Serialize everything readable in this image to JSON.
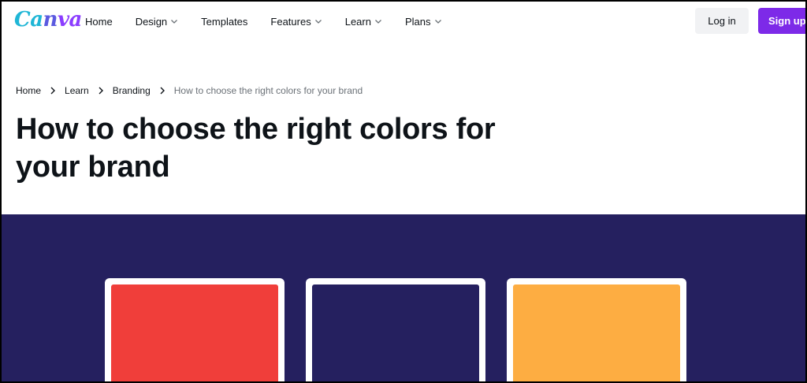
{
  "brand": {
    "logo_text": "Canva"
  },
  "nav": {
    "items": [
      {
        "label": "Home",
        "has_dropdown": false
      },
      {
        "label": "Design",
        "has_dropdown": true
      },
      {
        "label": "Templates",
        "has_dropdown": false
      },
      {
        "label": "Features",
        "has_dropdown": true
      },
      {
        "label": "Learn",
        "has_dropdown": true
      },
      {
        "label": "Plans",
        "has_dropdown": true
      }
    ],
    "login_label": "Log in",
    "signup_label": "Sign up"
  },
  "breadcrumb": {
    "items": [
      "Home",
      "Learn",
      "Branding"
    ],
    "current": "How to choose the right colors for your brand"
  },
  "page": {
    "title": "How to choose the right colors for your brand"
  },
  "hero": {
    "background_color": "#25205f",
    "swatches": [
      {
        "color": "#f03e3a"
      },
      {
        "color": "#25205f"
      },
      {
        "color": "#fdad42"
      }
    ]
  },
  "colors": {
    "accent": "#7d2ae8",
    "login_bg": "#f1f2f4",
    "logo_gradient_start": "#1fb6d6",
    "logo_gradient_end": "#8b3dff"
  }
}
